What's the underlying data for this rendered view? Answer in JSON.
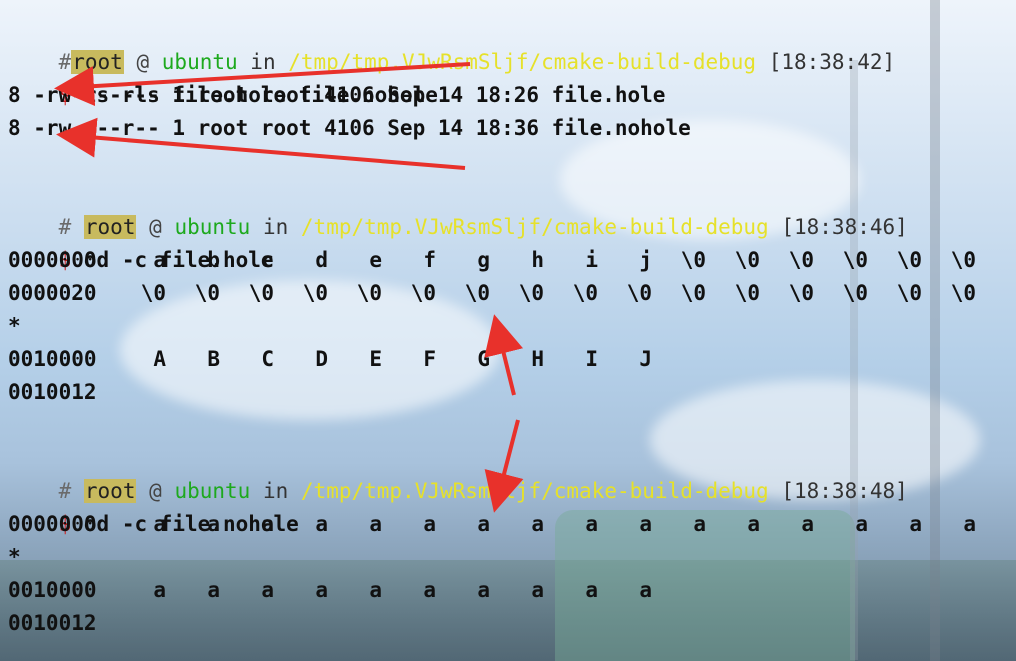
{
  "prompts": [
    {
      "hash": "#",
      "user": "root",
      "at": "@",
      "host": "ubuntu",
      "in": "in",
      "path": "/tmp/tmp.VJwRsmSljf/cmake-build-debug",
      "time": "[18:38:42]"
    },
    {
      "hash": "#",
      "user": "root",
      "at": "@",
      "host": "ubuntu",
      "in": "in",
      "path": "/tmp/tmp.VJwRsmSljf/cmake-build-debug",
      "time": "[18:38:46]"
    },
    {
      "hash": "#",
      "user": "root",
      "at": "@",
      "host": "ubuntu",
      "in": "in",
      "path": "/tmp/tmp.VJwRsmSljf/cmake-build-debug",
      "time": "[18:38:48]"
    }
  ],
  "dollar": "$",
  "commands": [
    "ls -ls file.hole file.nohole",
    "od -c file.hole",
    "od -c file.nohole"
  ],
  "ls_output": [
    "8 -rw-r--r-- 1 root root 4106 Sep 14 18:26 file.hole",
    "8 -rw-r--r-- 1 root root 4106 Sep 14 18:36 file.nohole"
  ],
  "od_hole": [
    {
      "offset": "0000000",
      "cells": [
        "a",
        "b",
        "c",
        "d",
        "e",
        "f",
        "g",
        "h",
        "i",
        "j",
        "\\0",
        "\\0",
        "\\0",
        "\\0",
        "\\0",
        "\\0"
      ]
    },
    {
      "offset": "0000020",
      "cells": [
        "\\0",
        "\\0",
        "\\0",
        "\\0",
        "\\0",
        "\\0",
        "\\0",
        "\\0",
        "\\0",
        "\\0",
        "\\0",
        "\\0",
        "\\0",
        "\\0",
        "\\0",
        "\\0"
      ]
    },
    {
      "offset": "*",
      "cells": []
    },
    {
      "offset": "0010000",
      "cells": [
        "A",
        "B",
        "C",
        "D",
        "E",
        "F",
        "G",
        "H",
        "I",
        "J"
      ]
    },
    {
      "offset": "0010012",
      "cells": []
    }
  ],
  "od_nohole": [
    {
      "offset": "0000000",
      "cells": [
        "a",
        "a",
        "a",
        "a",
        "a",
        "a",
        "a",
        "a",
        "a",
        "a",
        "a",
        "a",
        "a",
        "a",
        "a",
        "a"
      ]
    },
    {
      "offset": "*",
      "cells": []
    },
    {
      "offset": "0010000",
      "cells": [
        "a",
        "a",
        "a",
        "a",
        "a",
        "a",
        "a",
        "a",
        "a",
        "a"
      ]
    },
    {
      "offset": "0010012",
      "cells": []
    }
  ],
  "colors": {
    "user_bg": "#c8ba5e",
    "host": "#1da91d",
    "path": "#e6e12a",
    "dollar": "#d11a1a",
    "arrow": "#e8312b"
  }
}
